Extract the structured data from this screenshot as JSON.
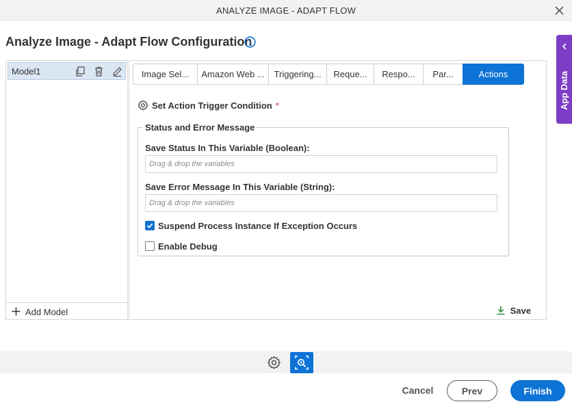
{
  "window": {
    "title": "ANALYZE IMAGE - ADAPT FLOW"
  },
  "config": {
    "title": "Analyze Image - Adapt Flow Configuration"
  },
  "app_data": {
    "label": "App Data"
  },
  "models": {
    "items": [
      {
        "name": "Model1"
      }
    ],
    "add_label": "Add Model"
  },
  "tabs": [
    {
      "label": "Image Sel..."
    },
    {
      "label": "Amazon Web ..."
    },
    {
      "label": "Triggering..."
    },
    {
      "label": "Reque..."
    },
    {
      "label": "Respo..."
    },
    {
      "label": "Par..."
    },
    {
      "label": "Actions"
    }
  ],
  "actions": {
    "trigger_label": "Set Action Trigger Condition",
    "required_mark": "*",
    "group_title": "Status and Error Message",
    "status_label": "Save Status In This Variable (Boolean):",
    "status_placeholder": "Drag & drop the variables",
    "error_label": "Save Error Message In This Variable (String):",
    "error_placeholder": "Drag & drop the variables",
    "suspend_label": "Suspend Process Instance If Exception Occurs",
    "suspend_checked": true,
    "debug_label": "Enable Debug",
    "debug_checked": false,
    "save_label": "Save"
  },
  "footer": {
    "cancel": "Cancel",
    "prev": "Prev",
    "finish": "Finish"
  },
  "colors": {
    "accent": "#0d73d6",
    "app_data_tab": "#7e3cc7",
    "required": "#d62f2f",
    "save_icon": "#2e8b3a"
  }
}
